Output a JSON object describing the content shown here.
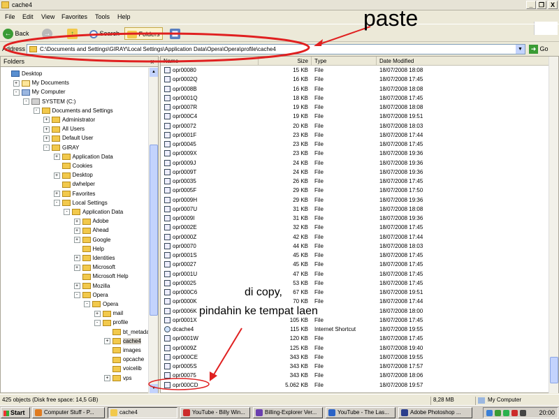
{
  "window": {
    "title": "cache4",
    "min": "_",
    "max": "❐",
    "close": "X"
  },
  "menu": [
    "File",
    "Edit",
    "View",
    "Favorites",
    "Tools",
    "Help"
  ],
  "toolbar": {
    "back": "Back",
    "search": "Search",
    "folders": "Folders"
  },
  "address": {
    "label": "Address",
    "path": "C:\\Documents and Settings\\GIRAY\\Local Settings\\Application Data\\Opera\\Opera\\profile\\cache4",
    "go": "Go"
  },
  "folders_pane": {
    "title": "Folders",
    "close": "x",
    "tree": [
      {
        "label": "Desktop",
        "pm": "",
        "icon": "dsk"
      },
      {
        "label": "My Documents",
        "pm": "+",
        "icon": "doc"
      },
      {
        "label": "My Computer",
        "pm": "-",
        "icon": "pc"
      },
      {
        "label": "SYSTEM (C:)",
        "pm": "-",
        "icon": "drv"
      },
      {
        "label": "Documents and Settings",
        "pm": "-",
        "icon": "fld"
      },
      {
        "label": "Administrator",
        "pm": "+",
        "icon": "fld"
      },
      {
        "label": "All Users",
        "pm": "+",
        "icon": "fld"
      },
      {
        "label": "Default User",
        "pm": "+",
        "icon": "fld"
      },
      {
        "label": "GIRAY",
        "pm": "-",
        "icon": "fld"
      },
      {
        "label": "Application Data",
        "pm": "+",
        "icon": "fld"
      },
      {
        "label": "Cookies",
        "pm": "",
        "icon": "fld"
      },
      {
        "label": "Desktop",
        "pm": "+",
        "icon": "fld"
      },
      {
        "label": "dwhelper",
        "pm": "",
        "icon": "fld"
      },
      {
        "label": "Favorites",
        "pm": "+",
        "icon": "fld"
      },
      {
        "label": "Local Settings",
        "pm": "-",
        "icon": "fld"
      },
      {
        "label": "Application Data",
        "pm": "-",
        "icon": "fld"
      },
      {
        "label": "Adobe",
        "pm": "+",
        "icon": "fld"
      },
      {
        "label": "Ahead",
        "pm": "+",
        "icon": "fld"
      },
      {
        "label": "Google",
        "pm": "+",
        "icon": "fld"
      },
      {
        "label": "Help",
        "pm": "",
        "icon": "fld"
      },
      {
        "label": "Identities",
        "pm": "+",
        "icon": "fld"
      },
      {
        "label": "Microsoft",
        "pm": "+",
        "icon": "fld"
      },
      {
        "label": "Microsoft Help",
        "pm": "",
        "icon": "fld"
      },
      {
        "label": "Mozilla",
        "pm": "+",
        "icon": "fld"
      },
      {
        "label": "Opera",
        "pm": "-",
        "icon": "fld"
      },
      {
        "label": "Opera",
        "pm": "-",
        "icon": "fld"
      },
      {
        "label": "mail",
        "pm": "+",
        "icon": "fld"
      },
      {
        "label": "profile",
        "pm": "-",
        "icon": "fld"
      },
      {
        "label": "bt_metadata",
        "pm": "",
        "icon": "fld"
      },
      {
        "label": "cache4",
        "pm": "+",
        "icon": "fld",
        "selected": true
      },
      {
        "label": "images",
        "pm": "",
        "icon": "fld"
      },
      {
        "label": "opcache",
        "pm": "",
        "icon": "fld"
      },
      {
        "label": "voicelib",
        "pm": "",
        "icon": "fld"
      },
      {
        "label": "vps",
        "pm": "+",
        "icon": "fld"
      }
    ]
  },
  "columns": {
    "name": "Name",
    "size": "Size",
    "type": "Type",
    "date": "Date Modified"
  },
  "files": [
    {
      "name": "opr00080",
      "size": "15 KB",
      "type": "File",
      "date": "18/07/2008 18:08"
    },
    {
      "name": "opr0002Q",
      "size": "16 KB",
      "type": "File",
      "date": "18/07/2008 17:45"
    },
    {
      "name": "opr0008B",
      "size": "16 KB",
      "type": "File",
      "date": "18/07/2008 18:08"
    },
    {
      "name": "opr0001Q",
      "size": "18 KB",
      "type": "File",
      "date": "18/07/2008 17:45"
    },
    {
      "name": "opr0007R",
      "size": "19 KB",
      "type": "File",
      "date": "18/07/2008 18:08"
    },
    {
      "name": "opr000C4",
      "size": "19 KB",
      "type": "File",
      "date": "18/07/2008 19:51"
    },
    {
      "name": "opr00072",
      "size": "20 KB",
      "type": "File",
      "date": "18/07/2008 18:03"
    },
    {
      "name": "opr0001F",
      "size": "23 KB",
      "type": "File",
      "date": "18/07/2008 17:44"
    },
    {
      "name": "opr00045",
      "size": "23 KB",
      "type": "File",
      "date": "18/07/2008 17:45"
    },
    {
      "name": "opr0009X",
      "size": "23 KB",
      "type": "File",
      "date": "18/07/2008 19:36"
    },
    {
      "name": "opr0009J",
      "size": "24 KB",
      "type": "File",
      "date": "18/07/2008 19:36"
    },
    {
      "name": "opr0009T",
      "size": "24 KB",
      "type": "File",
      "date": "18/07/2008 19:36"
    },
    {
      "name": "opr00035",
      "size": "26 KB",
      "type": "File",
      "date": "18/07/2008 17:45"
    },
    {
      "name": "opr0005F",
      "size": "29 KB",
      "type": "File",
      "date": "18/07/2008 17:50"
    },
    {
      "name": "opr0009H",
      "size": "29 KB",
      "type": "File",
      "date": "18/07/2008 19:36"
    },
    {
      "name": "opr0007U",
      "size": "31 KB",
      "type": "File",
      "date": "18/07/2008 18:08"
    },
    {
      "name": "opr0009I",
      "size": "31 KB",
      "type": "File",
      "date": "18/07/2008 19:36"
    },
    {
      "name": "opr0002E",
      "size": "32 KB",
      "type": "File",
      "date": "18/07/2008 17:45"
    },
    {
      "name": "opr0000Z",
      "size": "42 KB",
      "type": "File",
      "date": "18/07/2008 17:44"
    },
    {
      "name": "opr00070",
      "size": "44 KB",
      "type": "File",
      "date": "18/07/2008 18:03"
    },
    {
      "name": "opr0001S",
      "size": "45 KB",
      "type": "File",
      "date": "18/07/2008 17:45"
    },
    {
      "name": "opr00027",
      "size": "45 KB",
      "type": "File",
      "date": "18/07/2008 17:45"
    },
    {
      "name": "opr0001U",
      "size": "47 KB",
      "type": "File",
      "date": "18/07/2008 17:45"
    },
    {
      "name": "opr00025",
      "size": "53 KB",
      "type": "File",
      "date": "18/07/2008 17:45"
    },
    {
      "name": "opr000C6",
      "size": "67 KB",
      "type": "File",
      "date": "18/07/2008 19:51"
    },
    {
      "name": "opr0000K",
      "size": "70 KB",
      "type": "File",
      "date": "18/07/2008 17:44"
    },
    {
      "name": "opr0006K",
      "size": "",
      "type": "",
      "date": "18/07/2008 18:00"
    },
    {
      "name": "opr0001X",
      "size": "105 KB",
      "type": "File",
      "date": "18/07/2008 17:45"
    },
    {
      "name": "dcache4",
      "size": "115 KB",
      "type": "Internet Shortcut",
      "date": "18/07/2008 19:55",
      "icon": "web"
    },
    {
      "name": "opr0001W",
      "size": "120 KB",
      "type": "File",
      "date": "18/07/2008 17:45"
    },
    {
      "name": "opr0009Z",
      "size": "125 KB",
      "type": "File",
      "date": "18/07/2008 19:40"
    },
    {
      "name": "opr000CE",
      "size": "343 KB",
      "type": "File",
      "date": "18/07/2008 19:55"
    },
    {
      "name": "opr0005S",
      "size": "343 KB",
      "type": "File",
      "date": "18/07/2008 17:57"
    },
    {
      "name": "opr00075",
      "size": "343 KB",
      "type": "File",
      "date": "18/07/2008 18:06"
    },
    {
      "name": "opr000CD",
      "size": "5.062 KB",
      "type": "File",
      "date": "18/07/2008 19:57"
    }
  ],
  "status": {
    "objects": "425 objects (Disk free space: 14,5 GB)",
    "size": "8,28 MB",
    "zone": "My Computer"
  },
  "taskbar": {
    "start": "Start",
    "tasks": [
      {
        "label": "Computer Stuff - P...",
        "color": "#e07b20"
      },
      {
        "label": "cache4",
        "color": "#f2c94c",
        "active": true
      },
      {
        "label": "YouTube - Billy Win...",
        "color": "#cc2b2b"
      },
      {
        "label": "Billing-Explorer Ver...",
        "color": "#6a3fb0"
      },
      {
        "label": "YouTube - The Las...",
        "color": "#2b63c6"
      },
      {
        "label": "Adobe Photoshop ...",
        "color": "#2b3e8c"
      }
    ],
    "clock": "20:00"
  },
  "annotations": {
    "paste": "paste",
    "copy": "di copy,",
    "move": "pindahin ke tempat laen"
  }
}
